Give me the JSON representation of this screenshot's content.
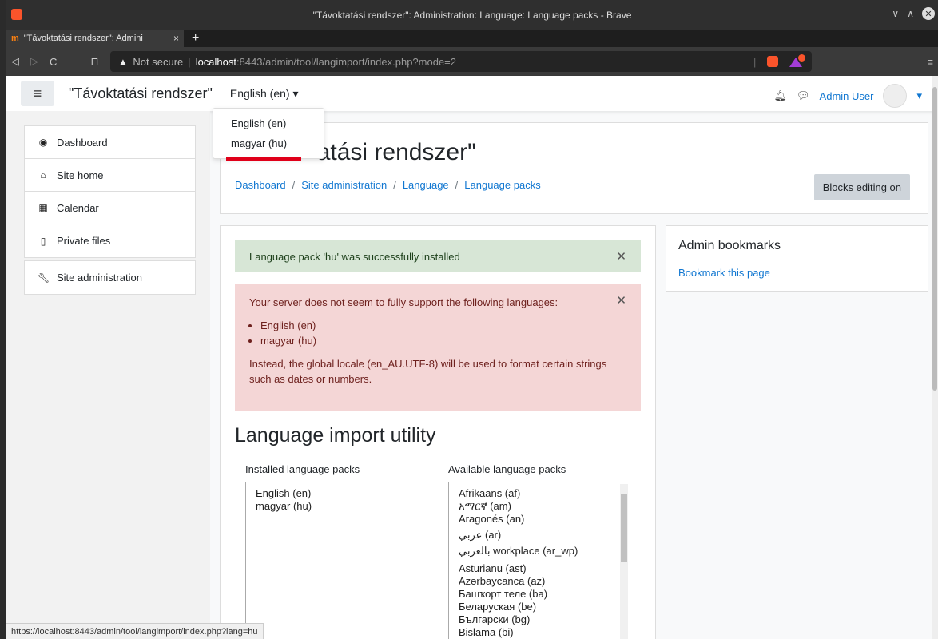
{
  "window": {
    "title": "\"Távoktatási rendszer\": Administration: Language: Language packs - Brave"
  },
  "tab": {
    "favicon": "m",
    "title": "\"Távoktatási rendszer\": Admini",
    "close": "×",
    "new": "+"
  },
  "address": {
    "security": "Not secure",
    "host": "localhost",
    "path": ":8443/admin/tool/langimport/index.php?mode=2"
  },
  "navbar": {
    "site_name": "\"Távoktatási rendszer\"",
    "language": "English (en) ▾",
    "user": "Admin User"
  },
  "lang_dropdown": {
    "options": [
      "English (en)",
      "magyar (hu)"
    ]
  },
  "sidebar": {
    "items": [
      {
        "label": "Dashboard",
        "icon": "dashboard-icon"
      },
      {
        "label": "Site home",
        "icon": "home-icon"
      },
      {
        "label": "Calendar",
        "icon": "calendar-icon"
      },
      {
        "label": "Private files",
        "icon": "file-icon"
      }
    ],
    "admin": {
      "label": "Site administration",
      "icon": "wrench-icon"
    }
  },
  "header": {
    "title": "\"Távoktatási rendszer\"",
    "title_visible_part": "atási rendszer\"",
    "breadcrumbs": [
      "Dashboard",
      "Site administration",
      "Language",
      "Language packs"
    ],
    "edit_button": "Blocks editing on"
  },
  "alerts": {
    "success": "Language pack 'hu' was successfully installed",
    "warning_intro": "Your server does not seem to fully support the following languages:",
    "warning_langs": [
      "English (en)",
      "magyar (hu)"
    ],
    "warning_outro": "Instead, the global locale (en_AU.UTF-8) will be used to format certain strings such as dates or numbers."
  },
  "import": {
    "heading": "Language import utility",
    "installed_label": "Installed language packs",
    "available_label": "Available language packs",
    "installed": [
      "English (en)",
      "magyar (hu)"
    ],
    "available": [
      "Afrikaans (af)",
      "አማርኛ (am)",
      "Aragonés (an)",
      "عربي (ar)",
      "بالعربي workplace (ar_wp)",
      "Asturianu (ast)",
      "Azərbaycanca (az)",
      "Башҡорт теле (ba)",
      "Беларуская (be)",
      "Български (bg)",
      "Bislama (bi)"
    ]
  },
  "bookmarks": {
    "title": "Admin bookmarks",
    "link": "Bookmark this page"
  },
  "statusbar": {
    "url": "https://localhost:8443/admin/tool/langimport/index.php?lang=hu"
  },
  "colors": {
    "link": "#1177d1",
    "success_bg": "#d7e6d6",
    "error_bg": "#f4d6d6",
    "annotation_red": "#e0001a"
  }
}
